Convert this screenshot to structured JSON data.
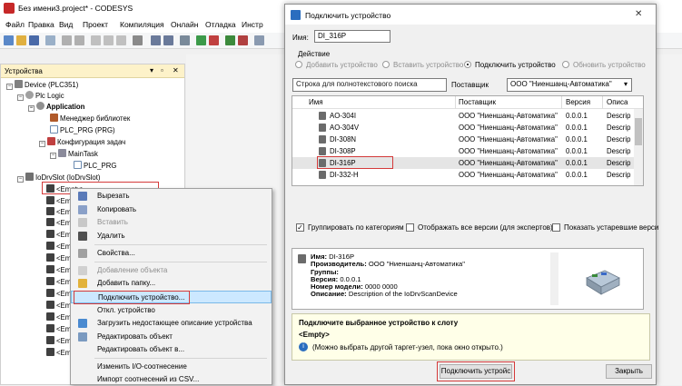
{
  "window": {
    "title": "Без имени3.project* - CODESYS"
  },
  "menu": [
    "Файл",
    "Правка",
    "Вид",
    "Проект",
    "Компиляция",
    "Онлайн",
    "Отладка",
    "Инстр"
  ],
  "devices_panel": {
    "title": "Устройства",
    "tree": [
      {
        "label": "Device (PLC351)",
        "bold": false
      },
      {
        "label": "Plc Logic",
        "bold": false
      },
      {
        "label": "Application",
        "bold": true
      },
      {
        "label": "Менеджер библиотек",
        "bold": false
      },
      {
        "label": "PLC_PRG (PRG)",
        "bold": false
      },
      {
        "label": "Конфигурация задач",
        "bold": false
      },
      {
        "label": "MainTask",
        "bold": false
      },
      {
        "label": "PLC_PRG",
        "bold": false
      },
      {
        "label": "IoDrvSlot (IoDrvSlot)",
        "bold": false
      },
      {
        "label": "<Empty>",
        "bold": false
      },
      {
        "label": "<Em",
        "bold": false
      },
      {
        "label": "<Em",
        "bold": false
      },
      {
        "label": "<Em",
        "bold": false
      },
      {
        "label": "<Em",
        "bold": false
      },
      {
        "label": "<Em",
        "bold": false
      },
      {
        "label": "<Em",
        "bold": false
      },
      {
        "label": "<Em",
        "bold": false
      },
      {
        "label": "<Em",
        "bold": false
      },
      {
        "label": "<Em",
        "bold": false
      },
      {
        "label": "<Em",
        "bold": false
      },
      {
        "label": "<Em",
        "bold": false
      },
      {
        "label": "<Em",
        "bold": false
      },
      {
        "label": "<Em",
        "bold": false
      },
      {
        "label": "<Em",
        "bold": false
      }
    ]
  },
  "context_menu": {
    "items": [
      {
        "label": "Вырезать",
        "disabled": false,
        "icon": "scissors-icon"
      },
      {
        "label": "Копировать",
        "disabled": false,
        "icon": "copy-icon"
      },
      {
        "label": "Вставить",
        "disabled": true,
        "icon": "paste-icon"
      },
      {
        "label": "Удалить",
        "disabled": false,
        "icon": "delete-icon"
      },
      {
        "label": "Свойства...",
        "disabled": false,
        "icon": "properties-icon"
      },
      {
        "label": "Добавление объекта",
        "disabled": true,
        "icon": "add-object-icon"
      },
      {
        "label": "Добавить папку...",
        "disabled": false,
        "icon": "folder-icon"
      },
      {
        "label": "Подключить устройство...",
        "disabled": false,
        "icon": ""
      },
      {
        "label": "Откл. устройство",
        "disabled": false,
        "icon": ""
      },
      {
        "label": "Загрузить недостающее описание устройства",
        "disabled": false,
        "icon": "download-icon"
      },
      {
        "label": "Редактировать объект",
        "disabled": false,
        "icon": "edit-icon"
      },
      {
        "label": "Редактировать объект в...",
        "disabled": false,
        "icon": ""
      },
      {
        "label": "Изменить I/O-соотнесение",
        "disabled": false,
        "icon": ""
      },
      {
        "label": "Импорт соотнесений из CSV...",
        "disabled": false,
        "icon": ""
      }
    ]
  },
  "dialog": {
    "title": "Подключить устройство",
    "name_label": "Имя:",
    "name_value": "DI_316P",
    "action_label": "Действие",
    "actions": [
      "Добавить устройство",
      "Вставить устройство",
      "Подключить устройство",
      "Обновить устройство"
    ],
    "selected_action": 2,
    "search_placeholder": "Строка для полнотекстового поиска",
    "vendor_label": "Поставщик",
    "vendor_value": "ООО \"Ниеншанц-Автоматика\"",
    "columns": [
      "Имя",
      "Поставщик",
      "Версия",
      "Описа"
    ],
    "devices": [
      {
        "name": "AO-304I",
        "vendor": "ООО \"Ниеншанц-Автоматика\"",
        "version": "0.0.0.1",
        "desc": "Descrip"
      },
      {
        "name": "AO-304V",
        "vendor": "ООО \"Ниеншанц-Автоматика\"",
        "version": "0.0.0.1",
        "desc": "Descrip"
      },
      {
        "name": "DI-308N",
        "vendor": "ООО \"Ниеншанц-Автоматика\"",
        "version": "0.0.0.1",
        "desc": "Descrip"
      },
      {
        "name": "DI-308P",
        "vendor": "ООО \"Ниеншанц-Автоматика\"",
        "version": "0.0.0.1",
        "desc": "Descrip"
      },
      {
        "name": "DI-316P",
        "vendor": "ООО \"Ниеншанц-Автоматика\"",
        "version": "0.0.0.1",
        "desc": "Descrip"
      },
      {
        "name": "DI-332-H",
        "vendor": "ООО \"Ниеншанц-Автоматика\"",
        "version": "0.0.0.1",
        "desc": "Descrip"
      }
    ],
    "selected_device": 4,
    "checkboxes": [
      {
        "label": "Группировать по категориям",
        "checked": true
      },
      {
        "label": "Отображать все версии (для экспертов)",
        "checked": false
      },
      {
        "label": "Показать устаревшие верси",
        "checked": false
      }
    ],
    "info": {
      "name_label": "Имя:",
      "name": "DI-316P",
      "vendor_label": "Производитель:",
      "vendor": "ООО \"Ниеншанц-Автоматика\"",
      "groups_label": "Группы:",
      "groups": "",
      "version_label": "Версия:",
      "version": "0.0.0.1",
      "model_label": "Номер модели:",
      "model": "0000 0000",
      "desc_label": "Описание:",
      "desc": "Description of the IoDrvScanDevice"
    },
    "hint_title": "Подключите выбранное устройство к слоту",
    "hint_slot": "<Empty>",
    "hint_note": "(Можно выбрать другой таргет-узел, пока окно открыто.)",
    "connect_button": "Подключить устройс",
    "close_button": "Закрыть"
  }
}
